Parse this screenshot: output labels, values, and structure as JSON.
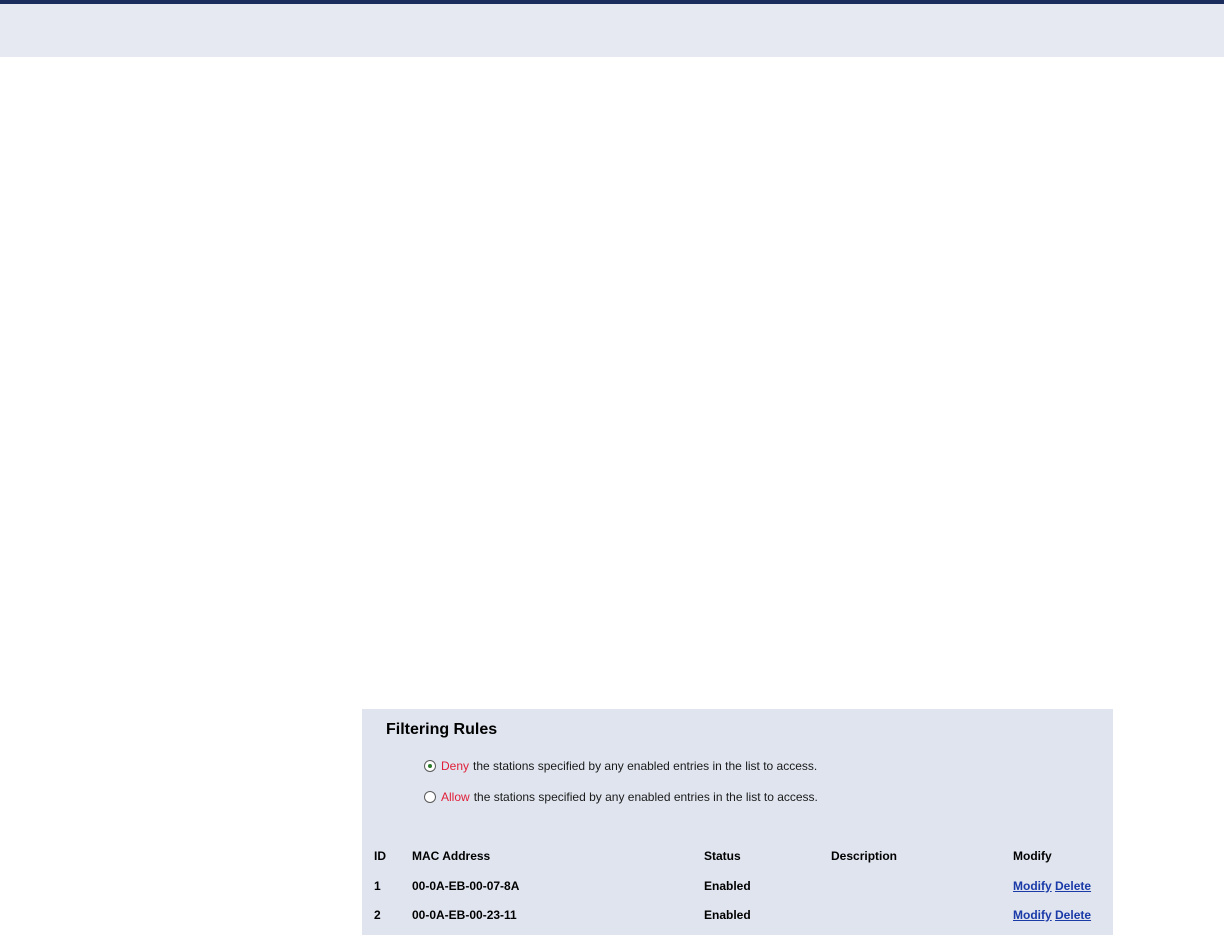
{
  "panel": {
    "title": "Filtering Rules",
    "options": [
      {
        "keyword": "Deny",
        "text": "the stations specified by any enabled entries in the list to access.",
        "checked": true
      },
      {
        "keyword": "Allow",
        "text": "the stations specified by any enabled entries in the list to access.",
        "checked": false
      }
    ]
  },
  "table": {
    "headers": {
      "id": "ID",
      "mac": "MAC Address",
      "status": "Status",
      "description": "Description",
      "modify": "Modify"
    },
    "rows": [
      {
        "id": "1",
        "mac": "00-0A-EB-00-07-8A",
        "status": "Enabled",
        "description": "",
        "modify_label": "Modify",
        "delete_label": "Delete"
      },
      {
        "id": "2",
        "mac": "00-0A-EB-00-23-11",
        "status": "Enabled",
        "description": "",
        "modify_label": "Modify",
        "delete_label": "Delete"
      }
    ]
  },
  "colors": {
    "header_rule": "#1a2d5c",
    "band": "#e6e9f2",
    "panel_bg": "#dfe4ee",
    "keyword": "#e0203a",
    "link": "#1a3aa8"
  }
}
